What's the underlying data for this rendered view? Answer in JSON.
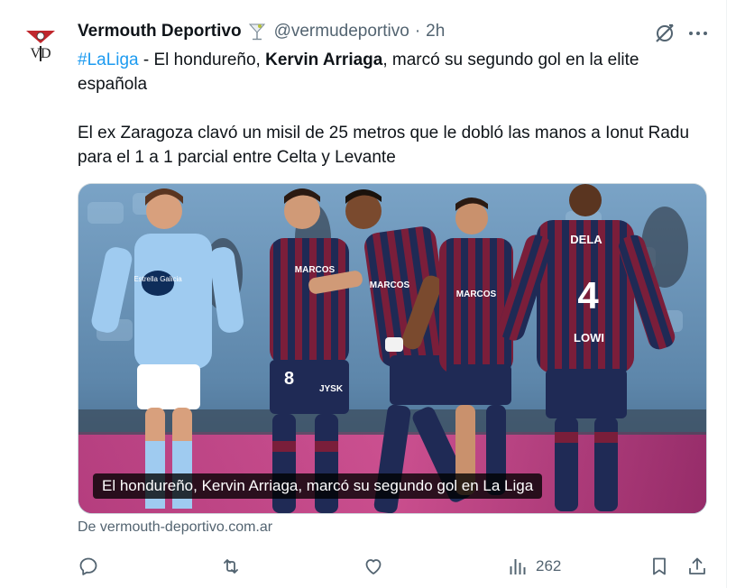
{
  "tweet": {
    "author_name": "Vermouth Deportivo",
    "handle": "@vermudeportivo",
    "separator": "·",
    "time": "2h",
    "avatar_text": "VD",
    "text": {
      "hashtag": "#LaLiga",
      "line1_a": " - El hondureño, ",
      "line1_bold": "Kervin Arriaga",
      "line1_b": ", marcó su segundo gol en la elite española",
      "paragraph2": "El ex Zaragoza clavó un misil de 25 metros que le dobló las manos a Ionut Radu para el 1 a 1 parcial entre Celta y Levante"
    },
    "media": {
      "caption": "El hondureño, Kervin Arriaga, marcó su segundo gol en La Liga",
      "shirt_texts": [
        "MARCOS",
        "MARCOS",
        "MARCOS",
        "DELA",
        "4",
        "LOWI",
        "8",
        "Estrella Galicia",
        "JYSK"
      ]
    },
    "source": "De vermouth-deportivo.com.ar",
    "actions": {
      "reply_icon": "reply-icon",
      "retweet_icon": "retweet-icon",
      "like_icon": "like-icon",
      "views_icon": "views-icon",
      "views_count": "262",
      "bookmark_icon": "bookmark-icon",
      "share_icon": "share-icon"
    },
    "colors": {
      "text_primary": "#0f1419",
      "text_secondary": "#536471",
      "link": "#1d9bf0"
    }
  }
}
